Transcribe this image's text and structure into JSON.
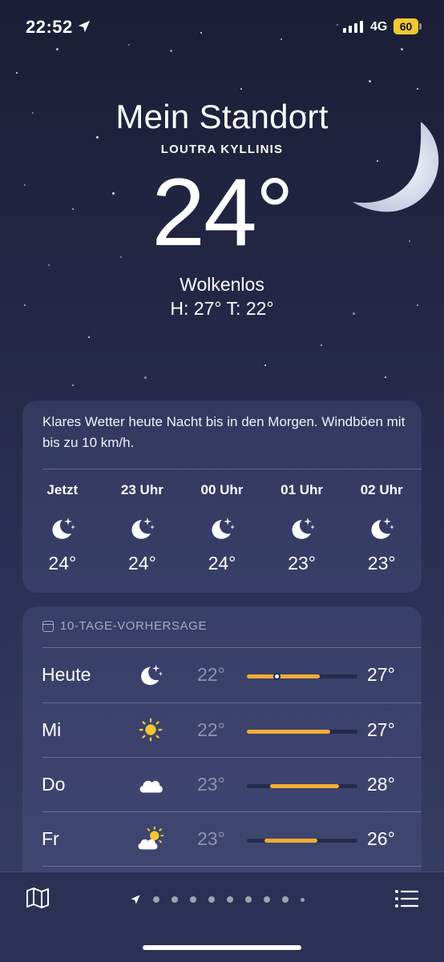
{
  "status_bar": {
    "time": "22:52",
    "network": "4G",
    "battery": "60"
  },
  "location": {
    "title": "Mein Standort",
    "place": "LOUTRA KYLLINIS"
  },
  "current": {
    "temperature": "24°",
    "condition": "Wolkenlos",
    "high_low": "H: 27°  T: 22°"
  },
  "hourly_card": {
    "summary": "Klares Wetter heute Nacht bis in den Morgen. Windböen mit bis zu 10 km/h.",
    "hours": [
      {
        "label": "Jetzt",
        "icon": "moon-stars-icon",
        "temp": "24°"
      },
      {
        "label": "23 Uhr",
        "icon": "moon-stars-icon",
        "temp": "24°"
      },
      {
        "label": "00 Uhr",
        "icon": "moon-stars-icon",
        "temp": "24°"
      },
      {
        "label": "01 Uhr",
        "icon": "moon-stars-icon",
        "temp": "23°"
      },
      {
        "label": "02 Uhr",
        "icon": "moon-stars-icon",
        "temp": "23°"
      }
    ]
  },
  "forecast": {
    "heading": "10-TAGE-VORHERSAGE",
    "days": [
      {
        "name": "Heute",
        "icon": "moon-stars-icon",
        "low": "22°",
        "high": "27°",
        "range_start": 0.0,
        "range_end": 0.66,
        "current_marker": 0.27
      },
      {
        "name": "Mi",
        "icon": "sun-icon",
        "low": "22°",
        "high": "27°",
        "range_start": 0.0,
        "range_end": 0.75
      },
      {
        "name": "Do",
        "icon": "cloud-icon",
        "low": "23°",
        "high": "28°",
        "range_start": 0.21,
        "range_end": 0.83
      },
      {
        "name": "Fr",
        "icon": "sun-behind-cloud-icon",
        "low": "23°",
        "high": "26°",
        "range_start": 0.16,
        "range_end": 0.64
      }
    ]
  },
  "colors": {
    "accent_bar": "#f3ad33",
    "battery": "#f2c830"
  }
}
